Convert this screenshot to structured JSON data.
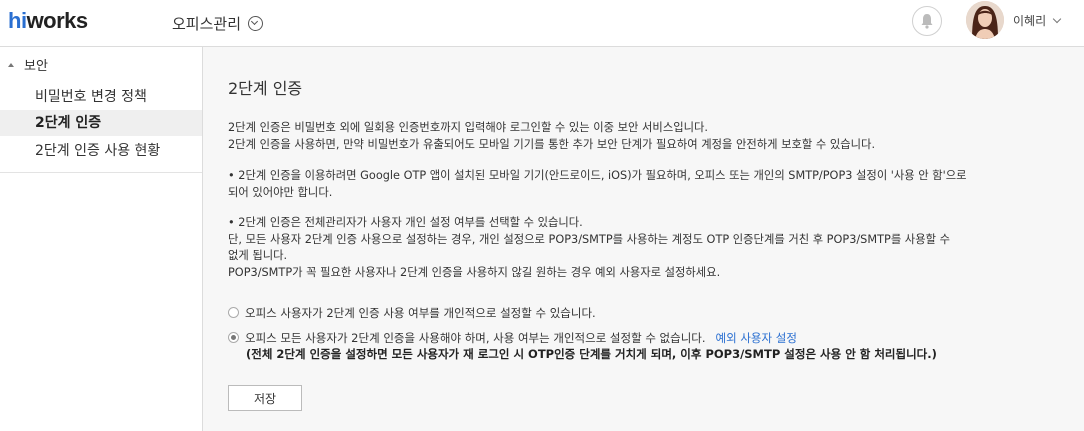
{
  "header": {
    "logo_hi": "hi",
    "logo_rest": "works",
    "app_menu_label": "오피스관리",
    "user_name": "이혜리"
  },
  "sidebar": {
    "group_label": "보안",
    "items": [
      {
        "label": "비밀번호 변경 정책"
      },
      {
        "label": "2단계 인증"
      },
      {
        "label": "2단계 인증 사용 현황"
      }
    ]
  },
  "main": {
    "title": "2단계 인증",
    "para1": "2단계 인증은 비밀번호 외에 일회용 인증번호까지 입력해야 로그인할 수 있는 이중 보안 서비스입니다.\n2단계 인증을 사용하면, 만약 비밀번호가 유출되어도 모바일 기기를 통한 추가 보안 단계가 필요하여 계정을 안전하게 보호할 수 있습니다.",
    "para2": "• 2단계 인증을 이용하려면 Google OTP 앱이 설치된 모바일 기기(안드로이드, iOS)가 필요하며, 오피스 또는 개인의 SMTP/POP3 설정이 '사용 안 함'으로\n되어 있어야만 합니다.",
    "para3": "• 2단계 인증은 전체관리자가 사용자 개인 설정 여부를 선택할 수 있습니다.\n   단, 모든 사용자 2단계 인증 사용으로 설정하는 경우, 개인 설정으로 POP3/SMTP를 사용하는 계정도 OTP 인증단계를 거친 후 POP3/SMTP를 사용할 수\n   없게 됩니다.\n   POP3/SMTP가 꼭 필요한 사용자나 2단계 인증을 사용하지 않길 원하는 경우 예외 사용자로 설정하세요.",
    "option1": "오피스 사용자가 2단계 인증 사용 여부를 개인적으로 설정할 수 있습니다.",
    "option2": "오피스 모든 사용자가 2단계 인증을 사용해야 하며, 사용 여부는 개인적으로 설정할 수 없습니다.",
    "option2_link": "예외 사용자 설정",
    "option2_note": "(전체 2단계 인증을 설정하면 모든 사용자가 재 로그인 시 OTP인증 단계를 거치게 되며, 이후 POP3/SMTP 설정은 사용 안 함 처리됩니다.)",
    "selected_option": 2,
    "save_label": "저장"
  },
  "colors": {
    "brand_blue": "#2a6fd1",
    "main_bg": "#f7f7f7",
    "active_item_bg": "#efefef"
  },
  "icons": [
    "chevron-down-circle-icon",
    "bell-icon",
    "chevron-down-icon",
    "collapse-triangle-icon"
  ]
}
